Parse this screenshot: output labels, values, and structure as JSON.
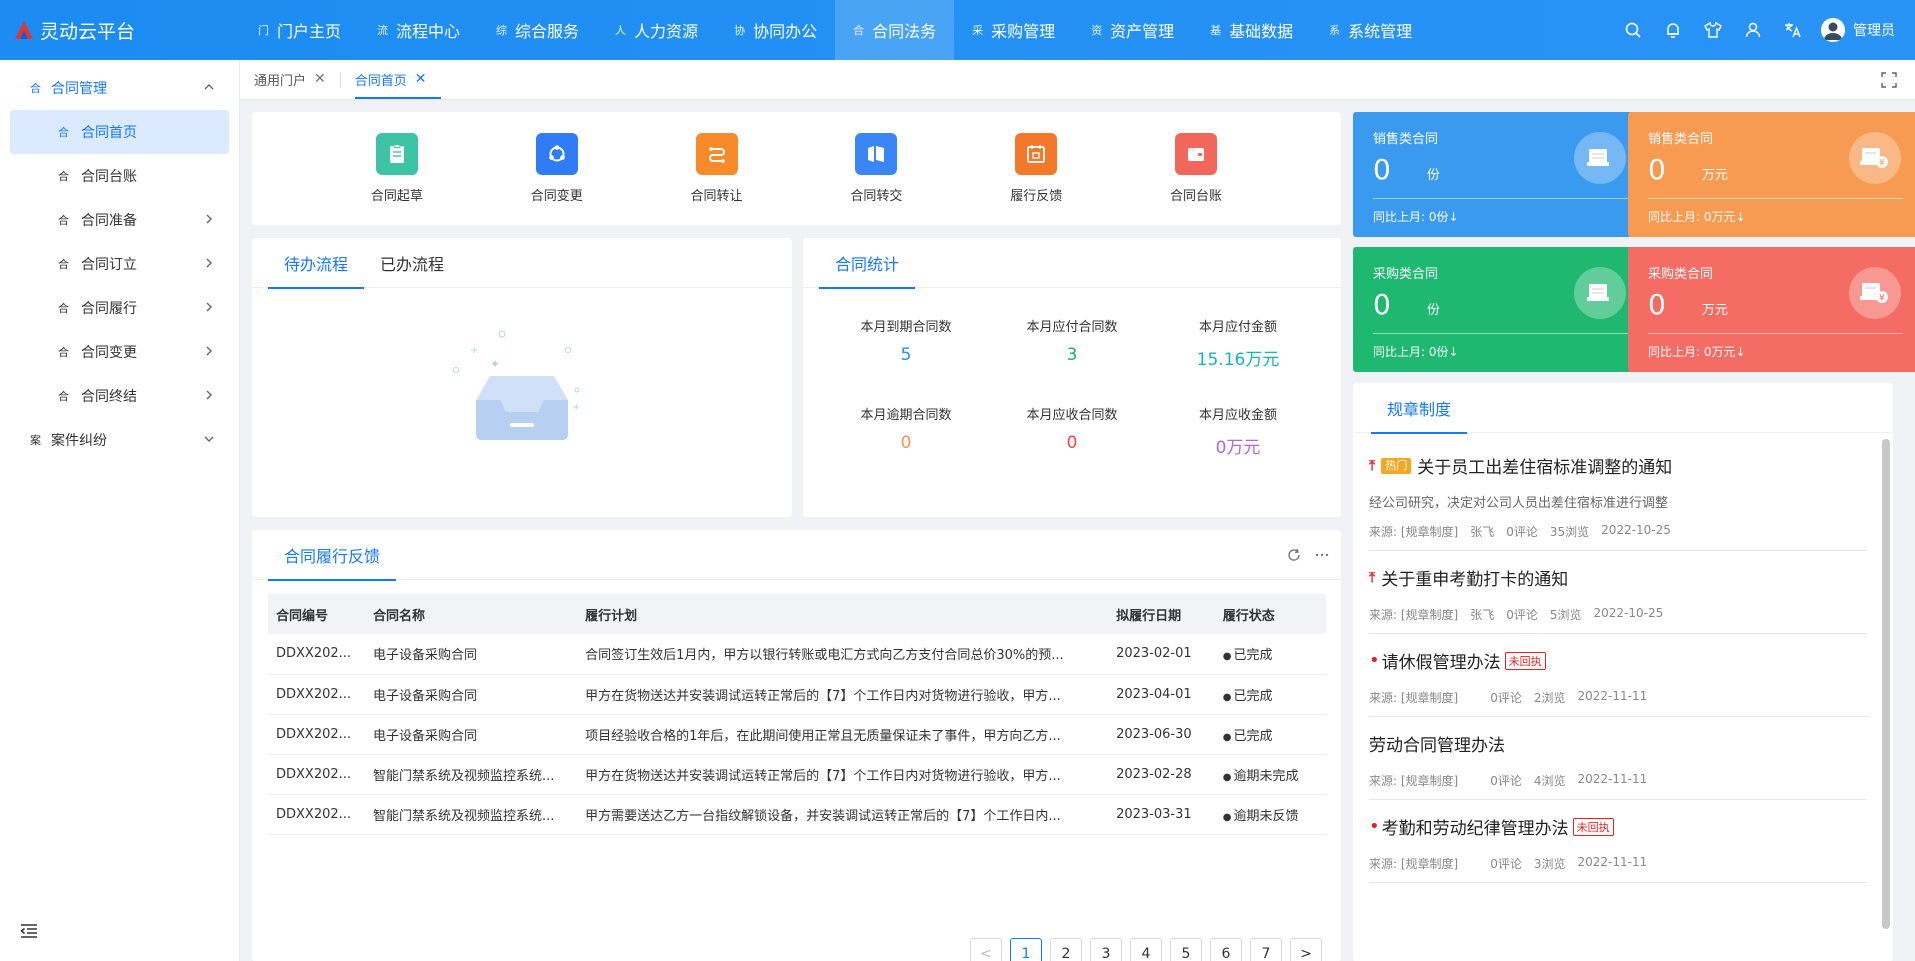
{
  "app": {
    "title": "灵动云平台"
  },
  "nav": {
    "items": [
      {
        "icon": "门",
        "label": "门户主页"
      },
      {
        "icon": "流",
        "label": "流程中心"
      },
      {
        "icon": "综",
        "label": "综合服务"
      },
      {
        "icon": "人",
        "label": "人力资源"
      },
      {
        "icon": "协",
        "label": "协同办公"
      },
      {
        "icon": "合",
        "label": "合同法务"
      },
      {
        "icon": "采",
        "label": "采购管理"
      },
      {
        "icon": "资",
        "label": "资产管理"
      },
      {
        "icon": "基",
        "label": "基础数据"
      },
      {
        "icon": "系",
        "label": "系统管理"
      }
    ],
    "active_index": 5,
    "user": "管理员"
  },
  "sidebar": {
    "group": {
      "icon": "合",
      "label": "合同管理"
    },
    "items": [
      {
        "icon": "合",
        "label": "合同首页"
      },
      {
        "icon": "合",
        "label": "合同台账"
      },
      {
        "icon": "合",
        "label": "合同准备"
      },
      {
        "icon": "合",
        "label": "合同订立"
      },
      {
        "icon": "合",
        "label": "合同履行"
      },
      {
        "icon": "合",
        "label": "合同变更"
      },
      {
        "icon": "合",
        "label": "合同终结"
      }
    ],
    "group2": {
      "icon": "案",
      "label": "案件纠纷"
    }
  },
  "page_tabs": [
    {
      "label": "通用门户"
    },
    {
      "label": "合同首页"
    }
  ],
  "quick": [
    {
      "label": "合同起草",
      "color": "#3cc4a4"
    },
    {
      "label": "合同变更",
      "color": "#2f7cf6"
    },
    {
      "label": "合同转让",
      "color": "#f78b2a"
    },
    {
      "label": "合同转交",
      "color": "#3a86f7"
    },
    {
      "label": "履行反馈",
      "color": "#f3782a"
    },
    {
      "label": "合同台账",
      "color": "#f2675c"
    }
  ],
  "todo": {
    "tab_pending": "待办流程",
    "tab_done": "已办流程"
  },
  "stats": {
    "tab": "合同统计",
    "items": [
      {
        "label": "本月到期合同数",
        "value": "5",
        "color": "#2a8cf0"
      },
      {
        "label": "本月应付合同数",
        "value": "3",
        "color": "#1fb35c"
      },
      {
        "label": "本月应付金额",
        "value": "15.16万元",
        "color": "#19b5b0"
      },
      {
        "label": "本月逾期合同数",
        "value": "0",
        "color": "#f19461"
      },
      {
        "label": "本月应收合同数",
        "value": "0",
        "color": "#f0474a"
      },
      {
        "label": "本月应收金额",
        "value": "0万元",
        "color": "#b069d8"
      }
    ]
  },
  "tiles": [
    {
      "title": "销售类合同",
      "value": "0",
      "unit": "份",
      "foot": "同比上月: 0份↓",
      "color": "#3a9af0"
    },
    {
      "title": "销售类合同",
      "value": "0",
      "unit": "万元",
      "foot": "同比上月: 0万元↓",
      "color": "#f79a52"
    },
    {
      "title": "采购类合同",
      "value": "0",
      "unit": "份",
      "foot": "同比上月: 0份↓",
      "color": "#1eb870"
    },
    {
      "title": "采购类合同",
      "value": "0",
      "unit": "万元",
      "foot": "同比上月: 0万元↓",
      "color": "#f46c63"
    }
  ],
  "feedback": {
    "tab": "合同履行反馈",
    "columns": [
      "合同编号",
      "合同名称",
      "履行计划",
      "拟履行日期",
      "履行状态"
    ],
    "rows": [
      {
        "code": "DDXX202...",
        "name": "电子设备采购合同",
        "plan": "合同签订生效后1月内，甲方以银行转账或电汇方式向乙方支付合同总价30%的预...",
        "date": "2023-02-01",
        "status": "已完成",
        "kind": "done"
      },
      {
        "code": "DDXX202...",
        "name": "电子设备采购合同",
        "plan": "甲方在货物送达并安装调试运转正常后的【7】个工作日内对货物进行验收，甲方...",
        "date": "2023-04-01",
        "status": "已完成",
        "kind": "done"
      },
      {
        "code": "DDXX202...",
        "name": "电子设备采购合同",
        "plan": "项目经验收合格的1年后，在此期间使用正常且无质量保证未了事件，甲方向乙方...",
        "date": "2023-06-30",
        "status": "已完成",
        "kind": "done"
      },
      {
        "code": "DDXX202...",
        "name": "智能门禁系统及视频监控系统...",
        "plan": "甲方在货物送达并安装调试运转正常后的【7】个工作日内对货物进行验收，甲方...",
        "date": "2023-02-28",
        "status": "逾期未完成",
        "kind": "overdue-incomplete"
      },
      {
        "code": "DDXX202...",
        "name": "智能门禁系统及视频监控系统...",
        "plan": "甲方需要送达乙方一台指纹解锁设备，并安装调试运转正常后的【7】个工作日内...",
        "date": "2023-03-31",
        "status": "逾期未反馈",
        "kind": "overdue-nofb"
      }
    ],
    "pages": [
      "1",
      "2",
      "3",
      "4",
      "5",
      "6",
      "7"
    ],
    "prev": "<",
    "next": ">"
  },
  "regs": {
    "tab": "规章制度",
    "items": [
      {
        "title": "关于员工出差住宿标准调整的通知",
        "pinned": true,
        "hot": "热门",
        "summary": "经公司研究，决定对公司人员出差住宿标准进行调整",
        "source": "来源: [规章制度]",
        "author": "张飞",
        "comments": "0评论",
        "views": "35浏览",
        "date": "2022-10-25"
      },
      {
        "title": "关于重申考勤打卡的通知",
        "pinned": true,
        "summary": "",
        "source": "来源: [规章制度]",
        "author": "张飞",
        "comments": "0评论",
        "views": "5浏览",
        "date": "2022-10-25"
      },
      {
        "title": "请休假管理办法",
        "dot": true,
        "badge": "未回执",
        "summary": "",
        "source": "来源: [规章制度]",
        "author": "",
        "comments": "0评论",
        "views": "2浏览",
        "date": "2022-11-11"
      },
      {
        "title": "劳动合同管理办法",
        "summary": "",
        "source": "来源: [规章制度]",
        "author": "",
        "comments": "0评论",
        "views": "4浏览",
        "date": "2022-11-11"
      },
      {
        "title": "考勤和劳动纪律管理办法",
        "dot": true,
        "badge": "未回执",
        "summary": "",
        "source": "来源: [规章制度]",
        "author": "",
        "comments": "0评论",
        "views": "3浏览",
        "date": "2022-11-11"
      }
    ]
  }
}
